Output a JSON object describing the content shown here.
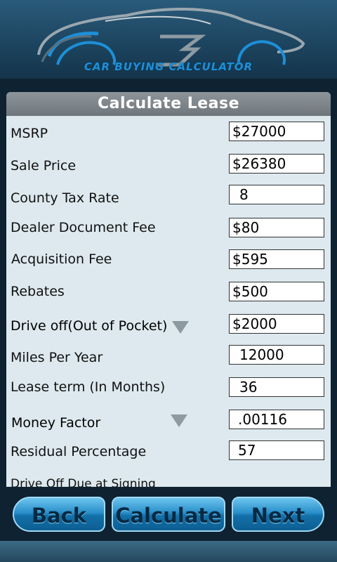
{
  "header": {
    "title": "CAR BUYING CALCULATOR"
  },
  "panel": {
    "title": "Calculate Lease"
  },
  "fields": [
    {
      "label": "MSRP",
      "value": "$27000"
    },
    {
      "label": "Sale Price",
      "value": "$26380"
    },
    {
      "label": "County Tax Rate",
      "value": "8"
    },
    {
      "label": "Dealer Document Fee",
      "value": "$80"
    },
    {
      "label": "Acquisition Fee",
      "value": "$595"
    },
    {
      "label": "Rebates",
      "value": "$500"
    },
    {
      "label": "Drive off(Out of Pocket)",
      "value": "$2000"
    },
    {
      "label": "Miles Per Year",
      "value": "12000"
    },
    {
      "label": "Lease term (In Months)",
      "value": "36"
    },
    {
      "label": "Money Factor",
      "value": ".00116"
    },
    {
      "label": "Residual Percentage",
      "value": "57"
    }
  ],
  "cut_off_label": "Drive Off Due at Signing",
  "buttons": {
    "back": "Back",
    "calculate": "Calculate",
    "next": "Next"
  }
}
